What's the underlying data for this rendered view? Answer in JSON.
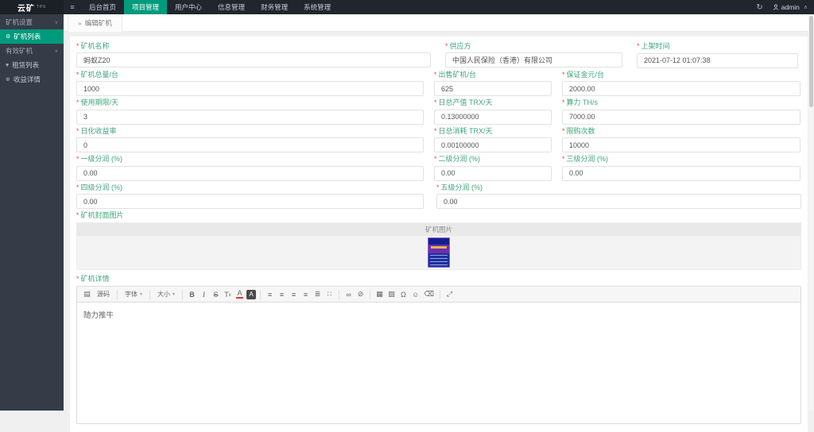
{
  "topbar": {
    "logo": "云矿",
    "logo_sup": "TP6",
    "menu": [
      {
        "label": "后台首页",
        "active": false
      },
      {
        "label": "项目管理",
        "active": true
      },
      {
        "label": "用户中心",
        "active": false
      },
      {
        "label": "信息管理",
        "active": false
      },
      {
        "label": "财务管理",
        "active": false
      },
      {
        "label": "系统管理",
        "active": false
      }
    ],
    "user": "admin"
  },
  "breadcrumb": {
    "prefix": "»",
    "label": "编辑矿机"
  },
  "sidebar": {
    "items": [
      {
        "kind": "group",
        "label": "矿机设置"
      },
      {
        "kind": "item",
        "label": "矿机列表",
        "icon": "gear-icon",
        "active": true
      },
      {
        "kind": "group",
        "label": "有效矿机"
      },
      {
        "kind": "item",
        "label": "租赁列表",
        "icon": "heart-icon",
        "active": false
      },
      {
        "kind": "item",
        "label": "收益详情",
        "icon": "circle-plus-icon",
        "active": false
      }
    ]
  },
  "form": {
    "required_mark": "*",
    "rows": [
      {
        "layout": "a",
        "fields": [
          {
            "label": "矿机名称",
            "value": "蚂蚁Z20"
          },
          {
            "label": "供应方",
            "value": "中国人民保险（香港）有限公司"
          },
          {
            "label": "上架时间",
            "value": "2021-07-12 01:07:38"
          }
        ]
      },
      {
        "layout": "b",
        "fields": [
          {
            "label": "矿机总量/台",
            "value": "1000"
          },
          {
            "label": "出售矿机/台",
            "value": "625"
          },
          {
            "label": "保证金元/台",
            "value": "2000.00"
          }
        ]
      },
      {
        "layout": "b",
        "fields": [
          {
            "label": "使用期限/天",
            "value": "3"
          },
          {
            "label": "日总产值 TRX/天",
            "value": "0.13000000"
          },
          {
            "label": "算力 TH/s",
            "value": "7000.00"
          }
        ]
      },
      {
        "layout": "b",
        "fields": [
          {
            "label": "日化收益率",
            "value": "0"
          },
          {
            "label": "日总消耗 TRX/天",
            "value": "0.00100000"
          },
          {
            "label": "限购次数",
            "value": "10000"
          }
        ]
      },
      {
        "layout": "b",
        "fields": [
          {
            "label": "一级分润 (%)",
            "value": "0.00"
          },
          {
            "label": "二级分润 (%)",
            "value": "0.00"
          },
          {
            "label": "三级分润 (%)",
            "value": "0.00"
          }
        ]
      },
      {
        "layout": "c",
        "fields": [
          {
            "label": "四级分润 (%)",
            "value": "0.00"
          },
          {
            "label": "五级分润 (%)",
            "value": "0.00"
          }
        ]
      }
    ],
    "cover": {
      "label": "矿机封面图片",
      "caption": "矿机图片"
    },
    "detail": {
      "label": "矿机详情",
      "content": "随力推牛",
      "toolbar": [
        {
          "t": "icon",
          "g": "▤",
          "name": "document-icon"
        },
        {
          "t": "text",
          "g": "源码",
          "name": "source-button"
        },
        {
          "t": "sep"
        },
        {
          "t": "text",
          "g": "字体",
          "caret": true,
          "name": "font-family-select"
        },
        {
          "t": "sep"
        },
        {
          "t": "text",
          "g": "大小",
          "caret": true,
          "name": "font-size-select"
        },
        {
          "t": "sep"
        },
        {
          "t": "icon",
          "g": "B",
          "cls": "b",
          "name": "bold-button"
        },
        {
          "t": "icon",
          "g": "I",
          "cls": "i",
          "name": "italic-button"
        },
        {
          "t": "icon",
          "g": "S",
          "cls": "s",
          "name": "strikethrough-button"
        },
        {
          "t": "sub",
          "g": "T",
          "sub": "x",
          "name": "subscript-button"
        },
        {
          "t": "colorA",
          "g": "A",
          "name": "text-color-button"
        },
        {
          "t": "bgA",
          "g": "A",
          "name": "bg-color-button"
        },
        {
          "t": "sep"
        },
        {
          "t": "icon",
          "g": "≡",
          "name": "align-left-button"
        },
        {
          "t": "icon",
          "g": "≡",
          "name": "align-center-button"
        },
        {
          "t": "icon",
          "g": "≡",
          "name": "align-right-button"
        },
        {
          "t": "icon",
          "g": "≡",
          "name": "align-justify-button"
        },
        {
          "t": "icon",
          "g": "≣",
          "name": "ordered-list-button"
        },
        {
          "t": "icon",
          "g": "∷",
          "name": "unordered-list-button"
        },
        {
          "t": "sep"
        },
        {
          "t": "icon",
          "g": "∞",
          "name": "link-button"
        },
        {
          "t": "icon",
          "g": "⊘",
          "name": "unlink-button"
        },
        {
          "t": "sep"
        },
        {
          "t": "icon",
          "g": "▦",
          "name": "table-button"
        },
        {
          "t": "icon",
          "g": "▨",
          "name": "image-button"
        },
        {
          "t": "icon",
          "g": "Ω",
          "name": "special-char-button"
        },
        {
          "t": "icon",
          "g": "☺",
          "name": "emoji-button"
        },
        {
          "t": "icon",
          "g": "⌫",
          "name": "remove-format-button"
        },
        {
          "t": "sep"
        },
        {
          "t": "icon",
          "g": "⤢",
          "name": "fullscreen-button"
        }
      ]
    }
  },
  "colors": {
    "accent_green": "#009b7c",
    "label_green": "#3fa579",
    "required_red": "#e8503a"
  }
}
